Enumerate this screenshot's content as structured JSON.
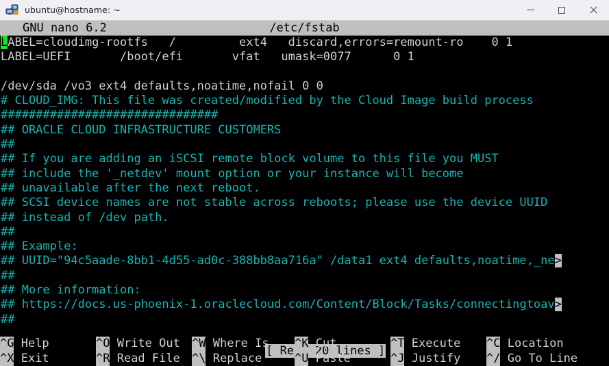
{
  "window": {
    "title": "ubuntu@hostname: ~",
    "icon": "putty-computer-icon",
    "controls": {
      "minimize": "minimize-icon",
      "maximize": "maximize-icon",
      "close": "close-icon"
    }
  },
  "editor": {
    "header": {
      "app": "GNU nano 6.2",
      "filename": "/etc/fstab"
    },
    "cursor": {
      "line": 1,
      "column": 1,
      "char": "L",
      "color": "#19e619"
    },
    "lines": [
      {
        "text": "ABEL=cloudimg-rootfs   /         ext4   discard,errors=remount-ro    0 1",
        "color": "white",
        "cursor_prefix": "L"
      },
      {
        "text": "LABEL=UEFI       /boot/efi       vfat   umask=0077      0 1",
        "color": "white"
      },
      {
        "text": "",
        "color": "white"
      },
      {
        "text": "/dev/sda /vo3 ext4 defaults,noatime,nofail 0 0",
        "color": "white"
      },
      {
        "text": "# CLOUD_IMG: This file was created/modified by the Cloud Image build process",
        "color": "cyan"
      },
      {
        "text": "###############################",
        "color": "cyan"
      },
      {
        "text": "## ORACLE CLOUD INFRASTRUCTURE CUSTOMERS",
        "color": "cyan"
      },
      {
        "text": "##",
        "color": "cyan"
      },
      {
        "text": "## If you are adding an iSCSI remote block volume to this file you MUST",
        "color": "cyan"
      },
      {
        "text": "## include the '_netdev' mount option or your instance will become",
        "color": "cyan"
      },
      {
        "text": "## unavailable after the next reboot.",
        "color": "cyan"
      },
      {
        "text": "## SCSI device names are not stable across reboots; please use the device UUID",
        "color": "cyan"
      },
      {
        "text": "## instead of /dev path.",
        "color": "cyan"
      },
      {
        "text": "##",
        "color": "cyan"
      },
      {
        "text": "## Example:",
        "color": "cyan"
      },
      {
        "text": "## UUID=\"94c5aade-8bb1-4d55-ad0c-388bb8aa716a\" /data1 ext4 defaults,noatime,_ne",
        "color": "cyan",
        "wrap": ">"
      },
      {
        "text": "##",
        "color": "cyan"
      },
      {
        "text": "## More information:",
        "color": "cyan"
      },
      {
        "text": "## https://docs.us-phoenix-1.oraclecloud.com/Content/Block/Tasks/connectingtoav",
        "color": "cyan",
        "wrap": ">"
      },
      {
        "text": "##",
        "color": "cyan"
      }
    ],
    "status": "[ Read 20 lines ]",
    "shortcuts": [
      [
        {
          "key": "^G",
          "label": "Help"
        },
        {
          "key": "^O",
          "label": "Write Out"
        },
        {
          "key": "^W",
          "label": "Where Is"
        },
        {
          "key": "^K",
          "label": "Cut"
        },
        {
          "key": "^T",
          "label": "Execute"
        },
        {
          "key": "^C",
          "label": "Location"
        }
      ],
      [
        {
          "key": "^X",
          "label": "Exit"
        },
        {
          "key": "^R",
          "label": "Read File"
        },
        {
          "key": "^\\",
          "label": "Replace"
        },
        {
          "key": "^U",
          "label": "Paste"
        },
        {
          "key": "^J",
          "label": "Justify"
        },
        {
          "key": "^/",
          "label": "Go To Line"
        }
      ]
    ]
  },
  "colors": {
    "terminal_bg": "#000000",
    "terminal_fg": "#d0d0d0",
    "comment": "#16b4b4",
    "reverse_bg": "#bfbfbf",
    "cursor": "#19e619",
    "titlebar_bg": "#f0f0f4"
  }
}
